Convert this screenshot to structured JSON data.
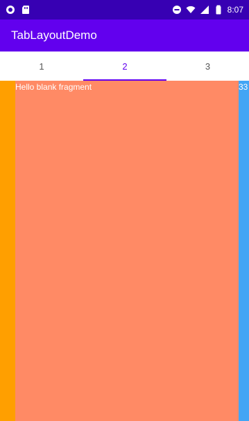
{
  "status_bar": {
    "time": "8:07",
    "left_icons": [
      "app-circle-icon",
      "sd-card-icon"
    ],
    "right_icons": [
      "do-not-disturb-icon",
      "wifi-icon",
      "signal-icon",
      "battery-icon"
    ]
  },
  "app_bar": {
    "title": "TabLayoutDemo"
  },
  "tabs": [
    {
      "label": "1"
    },
    {
      "label": "2"
    },
    {
      "label": "3"
    }
  ],
  "selected_tab_index": 1,
  "pager": {
    "left_page_color": "#ff9f00",
    "current_page_color": "#ff8a65",
    "right_page_color": "#42a5f5",
    "current_page_text": "Hello blank fragment",
    "right_page_text": "33"
  },
  "colors": {
    "primary": "#6200ee",
    "primary_dark": "#3700b3"
  }
}
